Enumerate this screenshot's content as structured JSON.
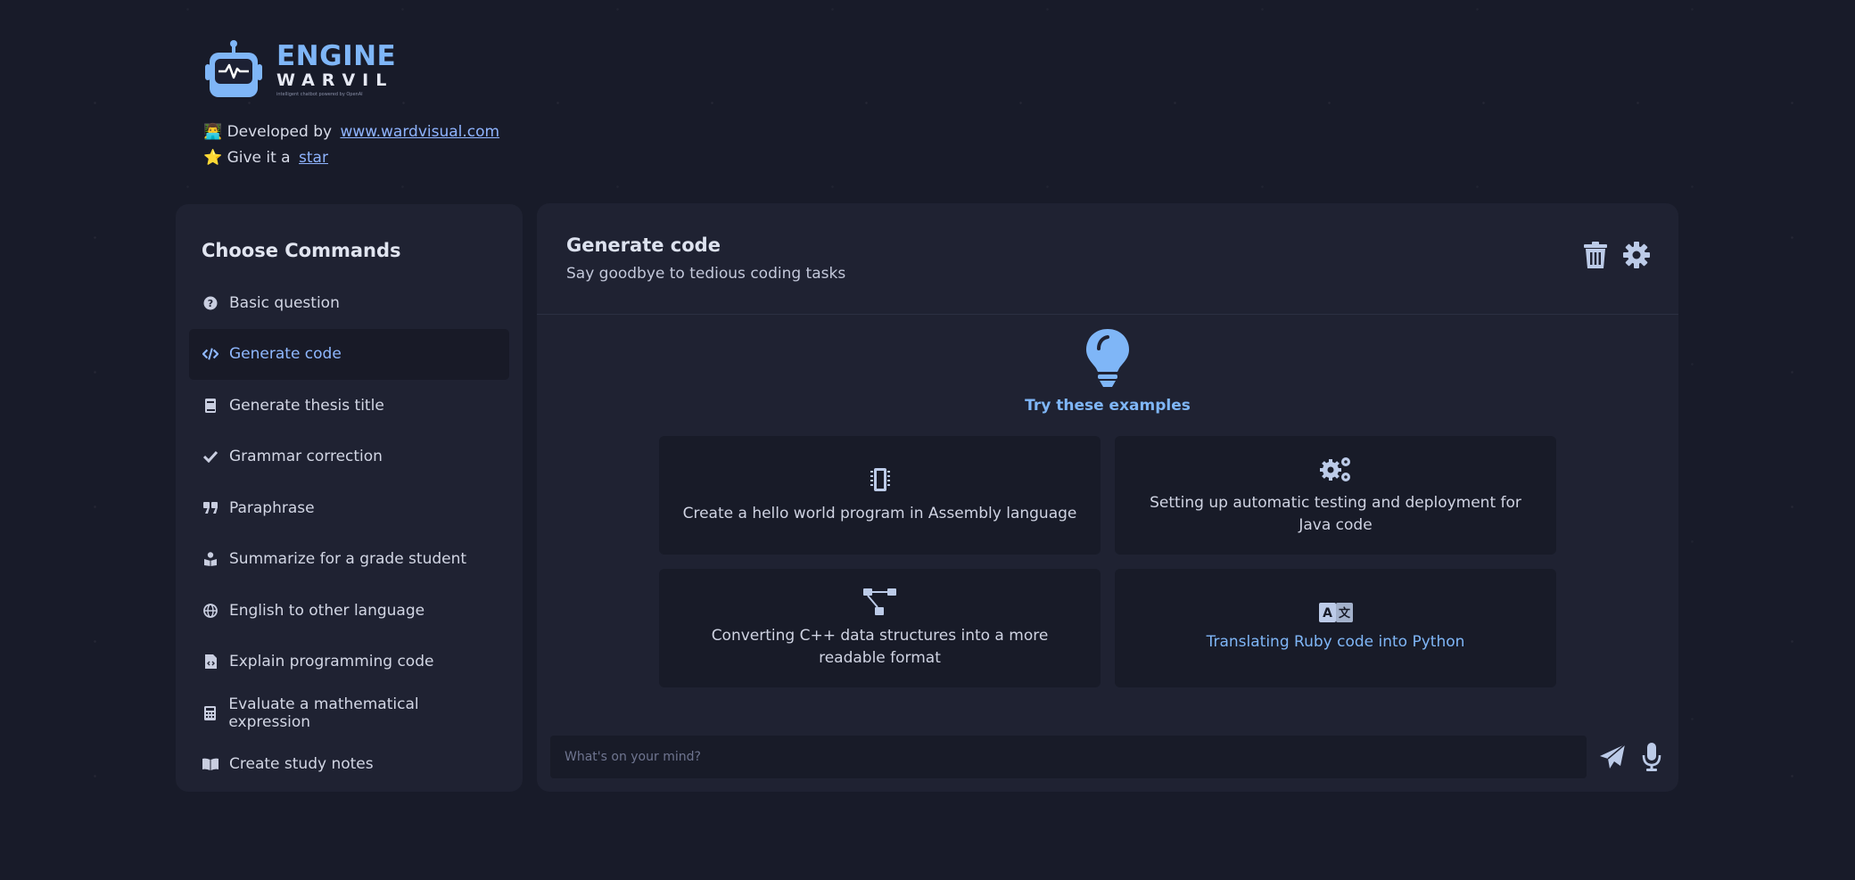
{
  "brand": {
    "name_top": "ENGINE",
    "name_bottom": "WARVIL",
    "tagline": "intelligent chatbot powered by OpenAI"
  },
  "credits": {
    "developed_prefix": "👨‍💻 Developed by",
    "developed_link": "www.wardvisual.com",
    "star_prefix": "⭐ Give it a",
    "star_link": "star"
  },
  "sidebar": {
    "title": "Choose Commands",
    "items": [
      {
        "label": "Basic question",
        "icon": "question-circle-icon"
      },
      {
        "label": "Generate code",
        "icon": "code-icon",
        "active": true
      },
      {
        "label": "Generate thesis title",
        "icon": "book-icon"
      },
      {
        "label": "Grammar correction",
        "icon": "check-icon"
      },
      {
        "label": "Paraphrase",
        "icon": "quote-icon"
      },
      {
        "label": "Summarize for a grade student",
        "icon": "student-icon"
      },
      {
        "label": "English to other language",
        "icon": "globe-icon"
      },
      {
        "label": "Explain programming code",
        "icon": "file-code-icon"
      },
      {
        "label": "Evaluate a mathematical expression",
        "icon": "calculator-icon"
      },
      {
        "label": "Create study notes",
        "icon": "open-book-icon"
      }
    ]
  },
  "main": {
    "title": "Generate code",
    "subtitle": "Say goodbye to tedious coding tasks",
    "examples_heading": "Try these examples",
    "examples": [
      {
        "text": "Create a hello world program in Assembly language",
        "icon": "microchip-icon"
      },
      {
        "text": "Setting up automatic testing and deployment for Java code",
        "icon": "gears-icon"
      },
      {
        "text": "Converting C++ data structures into a more readable format",
        "icon": "sitemap-icon"
      },
      {
        "text": "Translating Ruby code into Python",
        "icon": "translate-icon"
      }
    ],
    "input_placeholder": "What's on your mind?"
  },
  "colors": {
    "background": "#181b29",
    "panel": "#1f2232",
    "accent": "#7fb6f7"
  }
}
